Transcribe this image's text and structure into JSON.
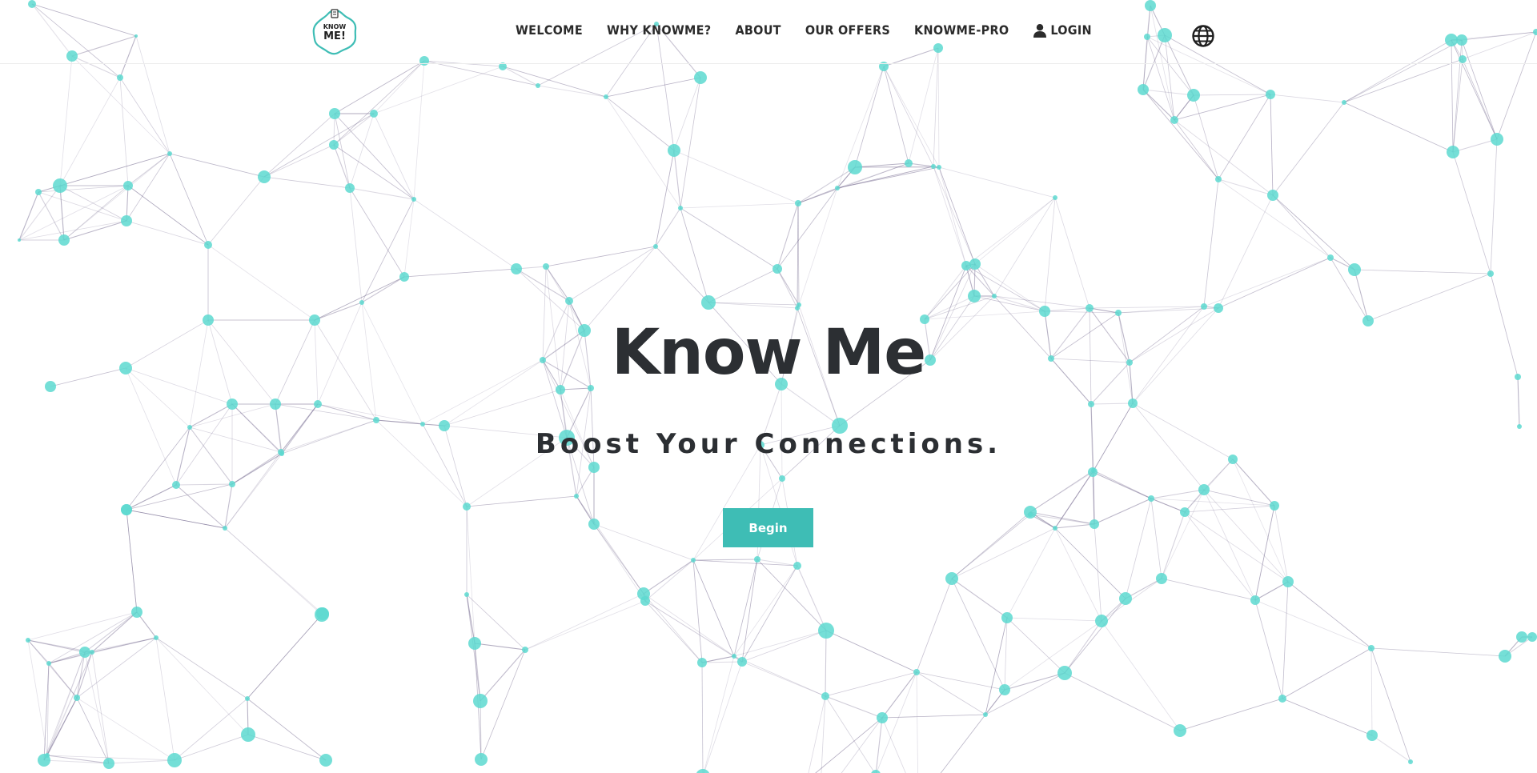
{
  "brand": {
    "logo_line1": "KNOW",
    "logo_line2": "ME!",
    "accent_color": "#3ebdb5",
    "node_color": "#5dd9d0"
  },
  "nav": {
    "items": [
      {
        "id": "welcome",
        "label": "WELCOME"
      },
      {
        "id": "why-knowme",
        "label": "WHY KNOWME?"
      },
      {
        "id": "about",
        "label": "ABOUT"
      },
      {
        "id": "our-offers",
        "label": "OUR OFFERS"
      },
      {
        "id": "knowme-pro",
        "label": "KNOWME-PRO"
      },
      {
        "id": "login",
        "label": "LOGIN",
        "icon": "user-icon"
      }
    ],
    "language_icon": "globe-icon"
  },
  "hero": {
    "title": "Know Me",
    "subtitle": "Boost Your Connections.",
    "cta_label": "Begin"
  }
}
